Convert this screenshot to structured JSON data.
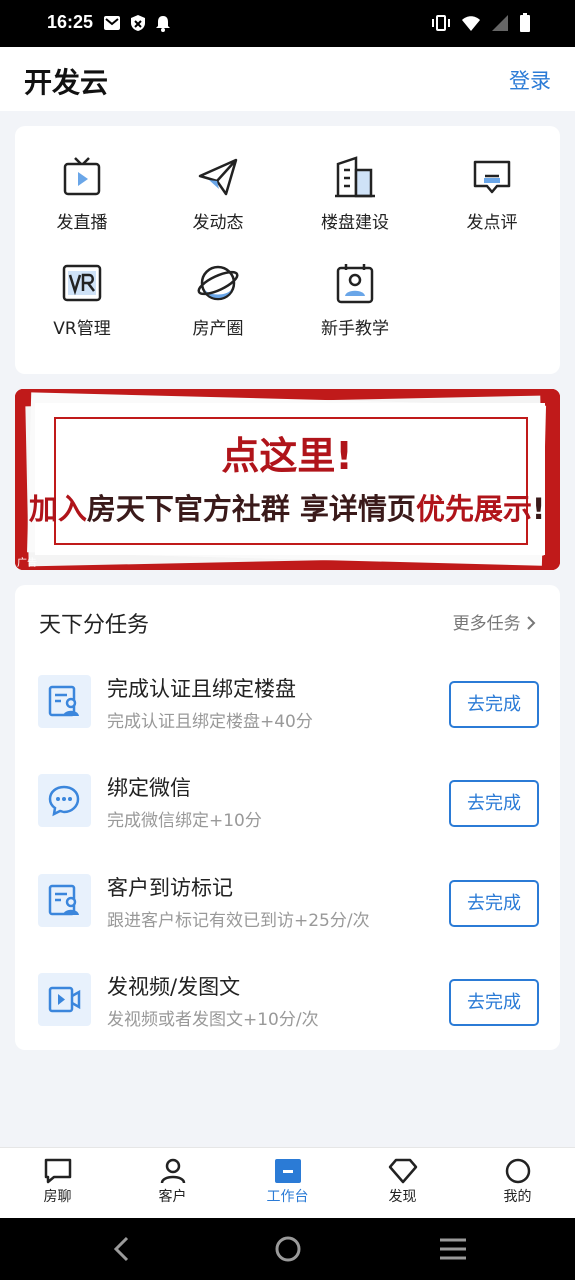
{
  "status_bar": {
    "time": "16:25"
  },
  "header": {
    "title": "开发云",
    "login_label": "登录"
  },
  "grid": {
    "items": [
      {
        "label": "发直播",
        "icon": "live-tv-icon"
      },
      {
        "label": "发动态",
        "icon": "paper-plane-icon"
      },
      {
        "label": "楼盘建设",
        "icon": "building-icon"
      },
      {
        "label": "发点评",
        "icon": "comment-icon"
      },
      {
        "label": "VR管理",
        "icon": "vr-icon"
      },
      {
        "label": "房产圈",
        "icon": "planet-icon"
      },
      {
        "label": "新手教学",
        "icon": "tutorial-icon"
      }
    ]
  },
  "banner": {
    "headline": "点这里!",
    "tagline_parts": [
      "加入",
      "房天下官方社群 享详情页",
      "优先展示",
      "!"
    ],
    "ad_tag": "广告"
  },
  "tasks": {
    "title": "天下分任务",
    "more_label": "更多任务",
    "items": [
      {
        "title": "完成认证且绑定楼盘",
        "subtitle": "完成认证且绑定楼盘+40分",
        "button": "去完成",
        "icon": "id-card-icon"
      },
      {
        "title": "绑定微信",
        "subtitle": "完成微信绑定+10分",
        "button": "去完成",
        "icon": "chat-bubble-icon"
      },
      {
        "title": "客户到访标记",
        "subtitle": "跟进客户标记有效已到访+25分/次",
        "button": "去完成",
        "icon": "id-card-icon"
      },
      {
        "title": "发视频/发图文",
        "subtitle": "发视频或者发图文+10分/次",
        "button": "去完成",
        "icon": "video-icon"
      }
    ]
  },
  "tab_bar": {
    "items": [
      {
        "label": "房聊",
        "icon": "chat-icon"
      },
      {
        "label": "客户",
        "icon": "person-icon"
      },
      {
        "label": "工作台",
        "icon": "workbench-icon",
        "active": true
      },
      {
        "label": "发现",
        "icon": "diamond-icon"
      },
      {
        "label": "我的",
        "icon": "profile-circle-icon"
      }
    ]
  },
  "colors": {
    "accent": "#2b7bd6",
    "banner_red": "#c01a1a",
    "banner_text": "#b0141a",
    "banner_text_dark": "#3a1a1a"
  }
}
